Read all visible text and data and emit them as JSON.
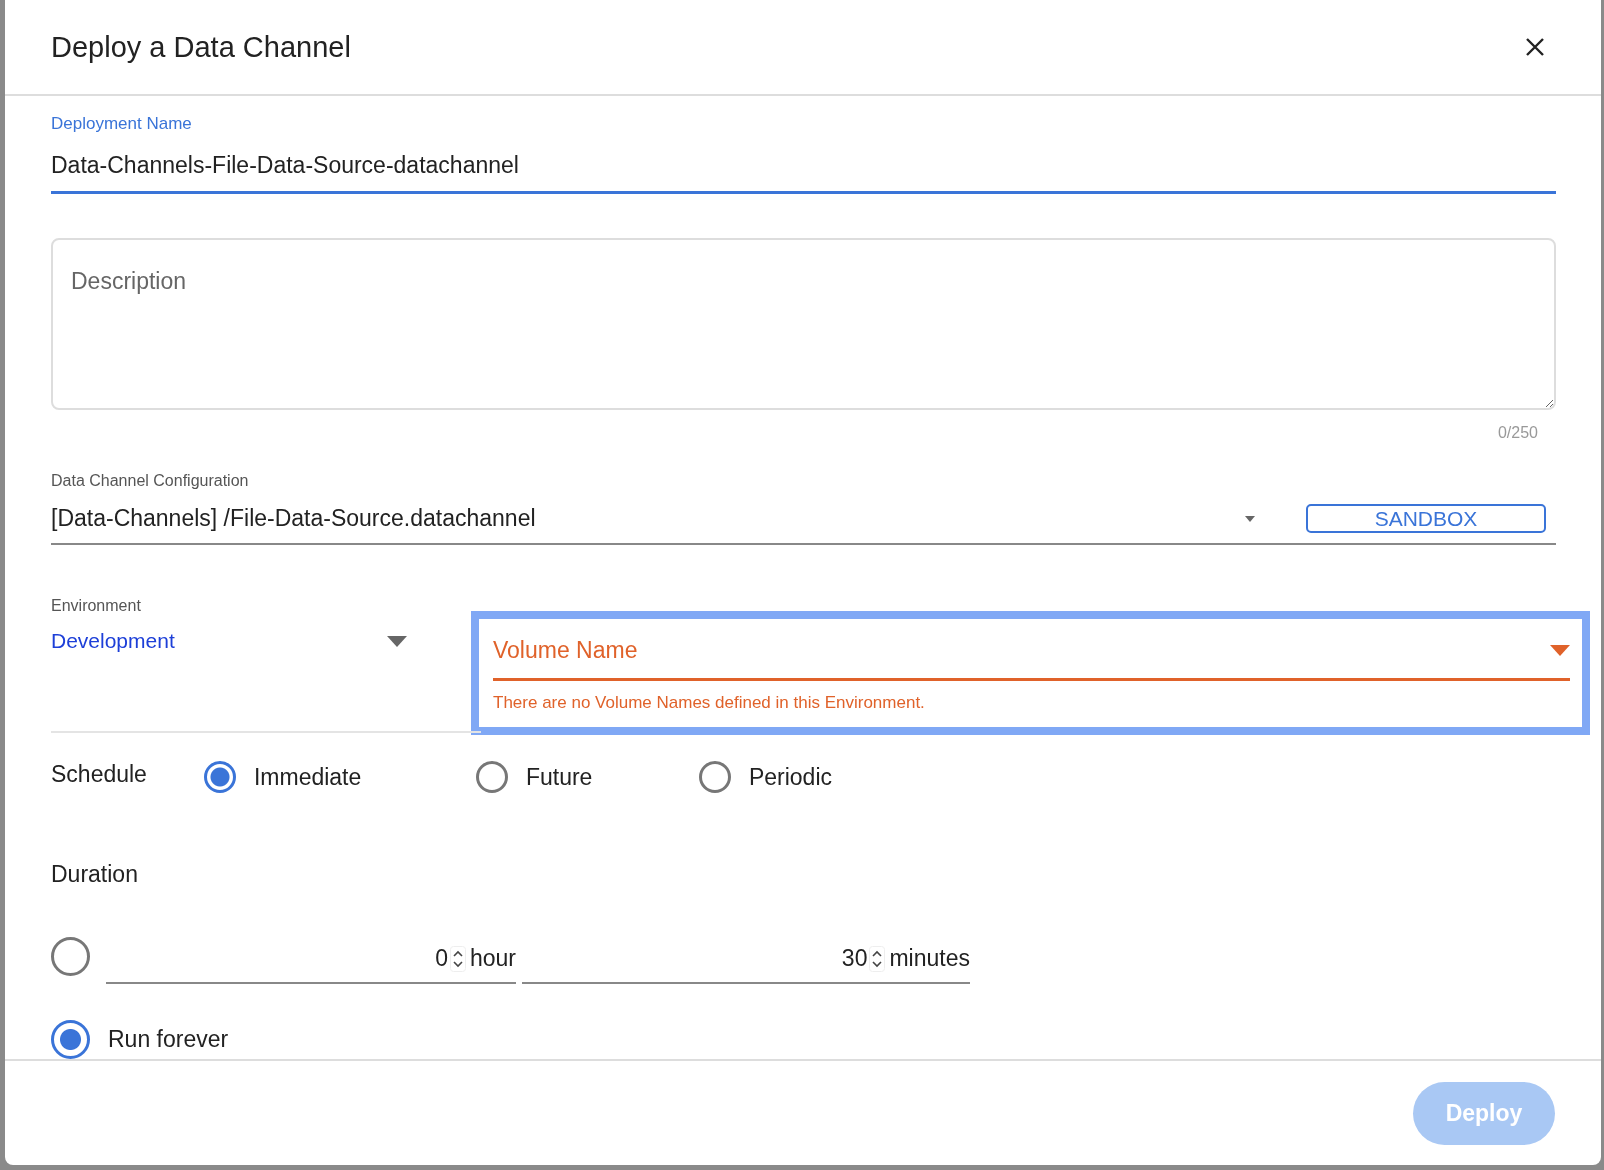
{
  "dialog": {
    "title": "Deploy a Data Channel"
  },
  "deployment_name": {
    "label": "Deployment Name",
    "value": "Data-Channels-File-Data-Source-datachannel",
    "focused": true
  },
  "description": {
    "placeholder": "Description",
    "counter": "0/250"
  },
  "configuration": {
    "label": "Data Channel Configuration",
    "value": "[Data-Channels] /File-Data-Source.datachannel",
    "button": "SANDBOX"
  },
  "environment": {
    "label": "Environment",
    "value": "Development"
  },
  "volume": {
    "placeholder": "Volume Name",
    "error": "There are no Volume Names defined in this Environment.",
    "highlighted": true
  },
  "schedule": {
    "label": "Schedule",
    "options": [
      {
        "label": "Immediate",
        "selected": true
      },
      {
        "label": "Future",
        "selected": false
      },
      {
        "label": "Periodic",
        "selected": false
      }
    ]
  },
  "duration": {
    "label": "Duration",
    "options": [
      {
        "kind": "time",
        "selected": false,
        "hours": "0",
        "hour_unit": "hour",
        "minutes": "30",
        "minute_unit": "minutes"
      },
      {
        "kind": "forever",
        "selected": true,
        "label": "Run forever"
      }
    ]
  },
  "deploy_button": {
    "label": "Deploy",
    "disabled": true
  }
}
